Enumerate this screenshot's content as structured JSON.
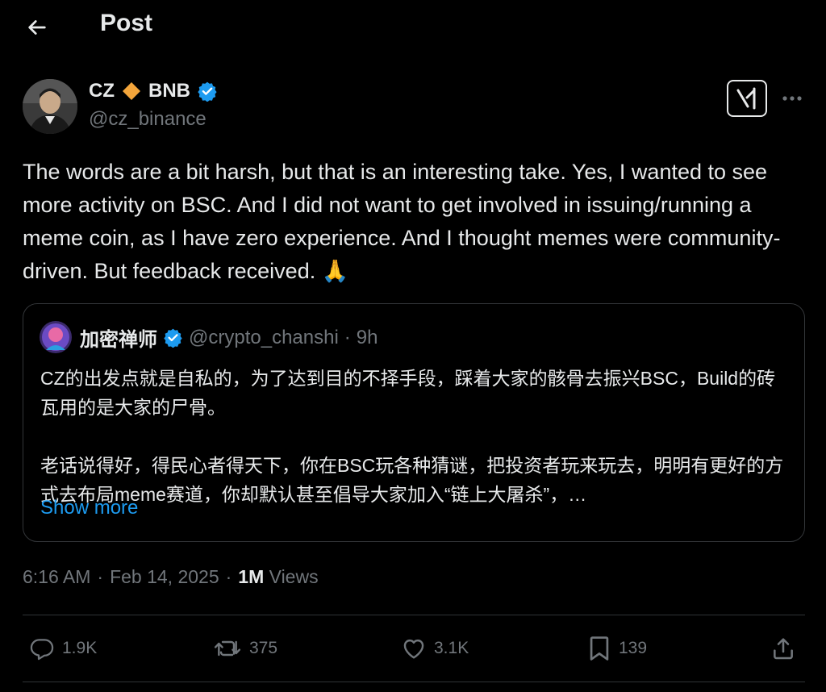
{
  "header": {
    "title": "Post"
  },
  "post": {
    "author_name": "CZ",
    "author_name_suffix": "BNB",
    "author_handle": "@cz_binance",
    "text": "The words are a bit harsh, but that is an interesting take. Yes, I wanted to see more activity on BSC. And I did not want to get involved in issuing/running a meme coin, as I have zero experience. And I thought memes were community-driven. But feedback received. 🙏",
    "time": "6:16 AM",
    "date": "Feb 14, 2025",
    "views_count": "1M",
    "views_label": "Views"
  },
  "quote": {
    "author_name": "加密禅师",
    "author_handle": "@crypto_chanshi",
    "time": "9h",
    "para1": "CZ的出发点就是自私的，为了达到目的不择手段，踩着大家的骸骨去振兴BSC，Build的砖瓦用的是大家的尸骨。",
    "para2": "老话说得好，得民心者得天下，你在BSC玩各种猜谜，把投资者玩来玩去，明明有更好的方式去布局meme赛道，你却默认甚至倡导大家加入“链上大屠杀”，…",
    "show_more": "Show more"
  },
  "actions": {
    "replies": "1.9K",
    "reposts": "375",
    "likes": "3.1K",
    "bookmarks": "139"
  },
  "colors": {
    "background": "#000000",
    "text": "#e7e9ea",
    "muted": "#71767b",
    "accent": "#1d9bf0",
    "verified": "#1d9bf0",
    "bnb_diamond": "#f3a53b",
    "border": "#2f3336"
  },
  "icons": {
    "back": "arrow-left-icon",
    "grok": "grok-icon",
    "more": "more-dots-icon",
    "verified": "verified-badge-icon",
    "reply": "reply-icon",
    "repost": "repost-icon",
    "like": "heart-icon",
    "bookmark": "bookmark-icon",
    "share": "share-icon"
  }
}
